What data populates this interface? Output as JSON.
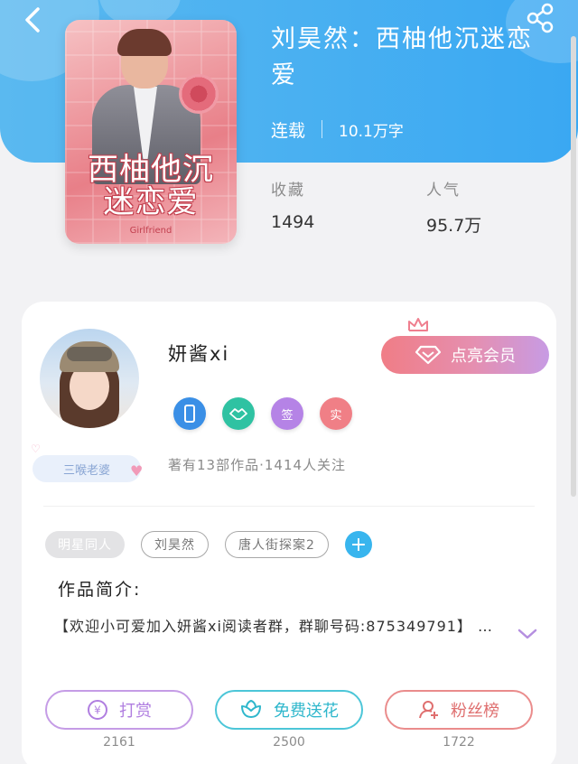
{
  "colors": {
    "header_blue": "#3aa8f2",
    "accent_blue": "#38b5ee",
    "reward_purple": "#b88ce0",
    "flower_teal": "#3cc2d4",
    "fans_red": "#e27a7a"
  },
  "header": {
    "back_icon": "chevron-left-icon",
    "share_icon": "share-icon"
  },
  "book": {
    "cover_title": "西柚他沉迷恋爱",
    "cover_subtitle": "Girlfriend",
    "title": "刘昊然：西柚他沉迷恋爱",
    "status": "连载",
    "word_count": "10.1万字",
    "stats": [
      {
        "label": "收藏",
        "value": "1494"
      },
      {
        "label": "人气",
        "value": "95.7万"
      }
    ]
  },
  "author": {
    "name": "妍酱xi",
    "badge_label": "三喉老婆",
    "member_button": "点亮会员",
    "badges": [
      {
        "icon": "phone-icon",
        "text": "",
        "color": "#3a8fe6"
      },
      {
        "icon": "handshake-icon",
        "text": "",
        "color": "#2fc2a2"
      },
      {
        "icon": "sign-icon",
        "text": "签",
        "color": "#b583e6"
      },
      {
        "icon": "verified-icon",
        "text": "实",
        "color": "#f07f86"
      }
    ],
    "stats_text": "著有13部作品·1414人关注"
  },
  "tags": [
    "明星同人",
    "刘昊然",
    "唐人街探案2"
  ],
  "intro": {
    "title": "作品简介:",
    "text": "【欢迎小可爱加入妍酱xi阅读者群，群聊号码:875349791】 …"
  },
  "actions": [
    {
      "label": "打赏",
      "icon": "yen-coin-icon",
      "count": "2161"
    },
    {
      "label": "免费送花",
      "icon": "flower-icon",
      "count": "2500"
    },
    {
      "label": "粉丝榜",
      "icon": "fans-icon",
      "count": "1722"
    }
  ]
}
